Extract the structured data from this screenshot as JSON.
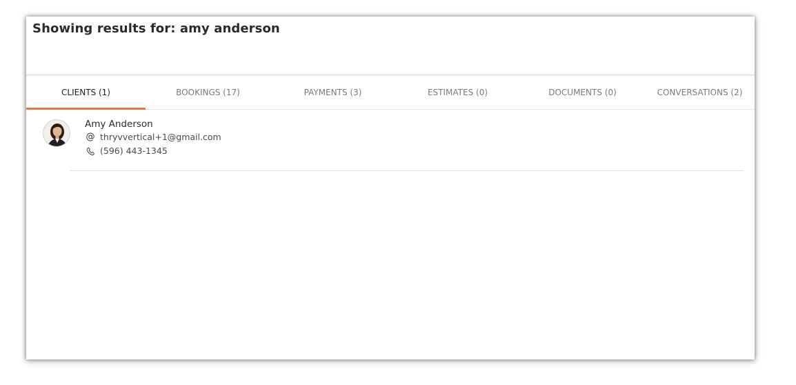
{
  "header": {
    "title": "Showing results for: amy anderson"
  },
  "tabs": [
    {
      "label": "CLIENTS (1)",
      "active": true
    },
    {
      "label": "BOOKINGS (17)",
      "active": false
    },
    {
      "label": "PAYMENTS (3)",
      "active": false
    },
    {
      "label": "ESTIMATES (0)",
      "active": false
    },
    {
      "label": "DOCUMENTS (0)",
      "active": false
    },
    {
      "label": "CONVERSATIONS (2)",
      "active": false
    }
  ],
  "clients": [
    {
      "name": "Amy Anderson",
      "email": "thryvvertical+1@gmail.com",
      "phone": "(596) 443-1345",
      "avatar_icon": "person-photo"
    }
  ],
  "icons": {
    "email": "at-icon",
    "phone": "phone-icon"
  },
  "colors": {
    "active_tab_underline": "#e57a3c",
    "title_text": "#2b2b2b",
    "inactive_tab_text": "#7b7b7b"
  }
}
